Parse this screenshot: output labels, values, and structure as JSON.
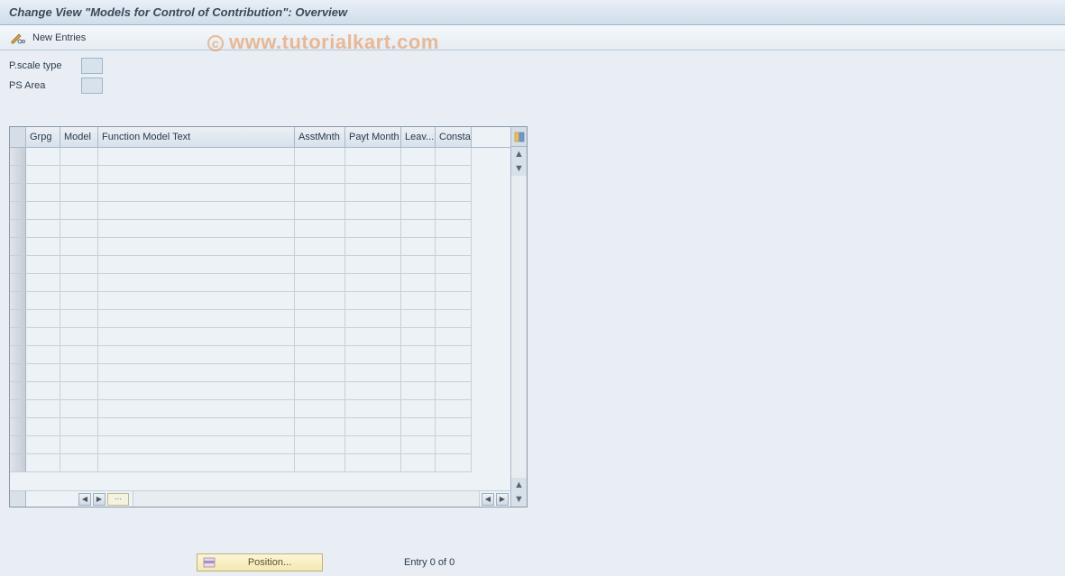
{
  "header": {
    "title": "Change View \"Models for Control of Contribution\": Overview"
  },
  "toolbar": {
    "new_entries_label": "New Entries"
  },
  "watermark": "www.tutorialkart.com",
  "fields": {
    "pscale_type_label": "P.scale type",
    "pscale_type_value": "",
    "psarea_label": "PS Area",
    "psarea_value": ""
  },
  "table": {
    "columns": [
      "Grpg",
      "Model",
      "Function Model Text",
      "AsstMnth",
      "Payt Month",
      "Leav...",
      "Consta"
    ],
    "row_count": 18,
    "rows": []
  },
  "footer": {
    "position_label": "Position...",
    "entry_status": "Entry 0 of 0"
  }
}
